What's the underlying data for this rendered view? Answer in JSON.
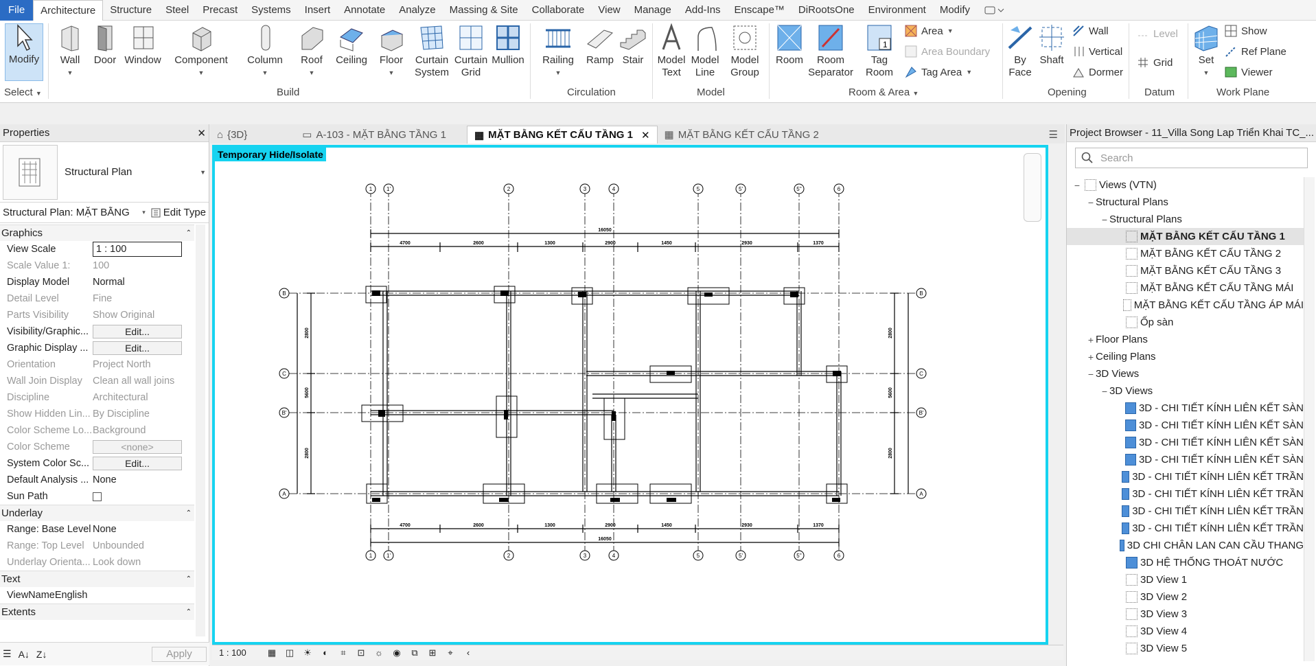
{
  "menu": [
    "File",
    "Architecture",
    "Structure",
    "Steel",
    "Precast",
    "Systems",
    "Insert",
    "Annotate",
    "Analyze",
    "Massing & Site",
    "Collaborate",
    "View",
    "Manage",
    "Add-Ins",
    "Enscape™",
    "DiRootsOne",
    "Environment",
    "Modify"
  ],
  "ribbon": {
    "modify": "Modify",
    "wall": "Wall",
    "door": "Door",
    "window": "Window",
    "component": "Component",
    "column": "Column",
    "roof": "Roof",
    "ceiling": "Ceiling",
    "floor": "Floor",
    "curtain_system": [
      "Curtain",
      "System"
    ],
    "curtain_grid": [
      "Curtain",
      "Grid"
    ],
    "mullion": "Mullion",
    "railing": "Railing",
    "ramp": "Ramp",
    "stair": "Stair",
    "model_text": [
      "Model",
      "Text"
    ],
    "model_line": [
      "Model",
      "Line"
    ],
    "model_group": [
      "Model",
      "Group"
    ],
    "room": "Room",
    "room_separator": [
      "Room",
      "Separator"
    ],
    "tag_room": [
      "Tag",
      "Room"
    ],
    "area": "Area",
    "area_boundary": "Area  Boundary",
    "tag_area": "Tag  Area",
    "by_face": [
      "By",
      "Face"
    ],
    "shaft": "Shaft",
    "wall_o": "Wall",
    "vertical": "Vertical",
    "dormer": "Dormer",
    "level": "Level",
    "grid": "Grid",
    "set": "Set",
    "show": "Show",
    "ref_plane": "Ref  Plane",
    "viewer": "Viewer",
    "panels": {
      "select": "Select",
      "build": "Build",
      "circulation": "Circulation",
      "model": "Model",
      "room_area": "Room & Area",
      "opening": "Opening",
      "datum": "Datum",
      "work_plane": "Work Plane"
    }
  },
  "properties": {
    "title": "Properties",
    "type_name": "Structural Plan",
    "selector": "Structural Plan: MẶT BẰNG",
    "edit_type": "Edit Type",
    "sections": {
      "graphics": "Graphics",
      "underlay": "Underlay",
      "text": "Text",
      "extents": "Extents"
    },
    "rows": [
      {
        "k": "View Scale",
        "v": "1 : 100",
        "kind": "input"
      },
      {
        "k": "Scale Value    1:",
        "v": "100",
        "dis": true
      },
      {
        "k": "Display Model",
        "v": "Normal"
      },
      {
        "k": "Detail Level",
        "v": "Fine",
        "dis": true
      },
      {
        "k": "Parts Visibility",
        "v": "Show Original",
        "dis": true
      },
      {
        "k": "Visibility/Graphic...",
        "v": "Edit...",
        "kind": "button"
      },
      {
        "k": "Graphic Display ...",
        "v": "Edit...",
        "kind": "button"
      },
      {
        "k": "Orientation",
        "v": "Project North",
        "dis": true
      },
      {
        "k": "Wall Join Display",
        "v": "Clean all wall joins",
        "dis": true
      },
      {
        "k": "Discipline",
        "v": "Architectural",
        "dis": true
      },
      {
        "k": "Show Hidden Lin...",
        "v": "By Discipline",
        "dis": true
      },
      {
        "k": "Color Scheme Lo...",
        "v": "Background",
        "dis": true
      },
      {
        "k": "Color Scheme",
        "v": "<none>",
        "kind": "button",
        "dis": true
      },
      {
        "k": "System Color Sc...",
        "v": "Edit...",
        "kind": "button"
      },
      {
        "k": "Default Analysis ...",
        "v": "None"
      },
      {
        "k": "Sun Path",
        "v": "",
        "kind": "checkbox"
      }
    ],
    "underlay_rows": [
      {
        "k": "Range: Base Level",
        "v": "None"
      },
      {
        "k": "Range: Top Level",
        "v": "Unbounded",
        "dis": true
      },
      {
        "k": "Underlay Orienta...",
        "v": "Look down",
        "dis": true
      }
    ],
    "text_rows": [
      {
        "k": "ViewNameEnglish",
        "v": ""
      }
    ],
    "apply": "Apply"
  },
  "tabs": [
    "{3D}",
    "A-103 - MẶT BẰNG TẦNG 1",
    "MẶT BẰNG KẾT CẤU TẦNG 1",
    "MẶT BẰNG KẾT CẤU TẦNG 2"
  ],
  "canvas": {
    "badge": "Temporary Hide/Isolate",
    "scale": "1 : 100",
    "grids_top": [
      "1",
      "1'",
      "2",
      "3",
      "4",
      "5",
      "5'",
      "5''",
      "6"
    ],
    "grids_side": [
      "B",
      "C",
      "B'",
      "A"
    ],
    "dims": [
      "4700",
      "2600",
      "1300",
      "2900",
      "1450",
      "2930",
      "1370"
    ],
    "total": "16050",
    "side_dims": [
      "2800",
      "5600",
      "2800"
    ]
  },
  "browser": {
    "title": "Project Browser - 11_Villa Song Lap Triển Khai TC_...",
    "search": "Search",
    "nodes": [
      {
        "t": "Views (VTN)",
        "lvl": 0,
        "tg": "−",
        "ic": "root"
      },
      {
        "t": "Structural Plans",
        "lvl": 1,
        "tg": "−"
      },
      {
        "t": "Structural Plans",
        "lvl": 2,
        "tg": "−"
      },
      {
        "t": "MẶT BẰNG KẾT CẤU TẦNG 1",
        "lvl": 3,
        "ic": "d",
        "cur": true
      },
      {
        "t": "MẶT BẰNG KẾT CẤU TẦNG 2",
        "lvl": 3,
        "ic": "d"
      },
      {
        "t": "MẶT BẰNG KẾT CẤU TẦNG 3",
        "lvl": 3,
        "ic": "d"
      },
      {
        "t": "MẶT BẰNG KẾT CẤU TẦNG MÁI",
        "lvl": 3,
        "ic": "d"
      },
      {
        "t": "MẶT BẰNG KẾT CẤU TẦNG ÁP MÁI",
        "lvl": 3,
        "ic": "d"
      },
      {
        "t": "Ốp sàn",
        "lvl": 3,
        "ic": "d"
      },
      {
        "t": "Floor Plans",
        "lvl": 1,
        "tg": "+"
      },
      {
        "t": "Ceiling Plans",
        "lvl": 1,
        "tg": "+"
      },
      {
        "t": "3D Views",
        "lvl": 1,
        "tg": "−"
      },
      {
        "t": "3D Views",
        "lvl": 2,
        "tg": "−"
      },
      {
        "t": "3D - CHI TIẾT KÍNH LIÊN KẾT SÀN",
        "lvl": 3,
        "ic": "b"
      },
      {
        "t": "3D - CHI TIẾT KÍNH LIÊN KẾT SÀN",
        "lvl": 3,
        "ic": "b"
      },
      {
        "t": "3D - CHI TIẾT KÍNH LIÊN KẾT SÀN",
        "lvl": 3,
        "ic": "b"
      },
      {
        "t": "3D - CHI TIẾT KÍNH LIÊN KẾT SÀN",
        "lvl": 3,
        "ic": "b"
      },
      {
        "t": "3D - CHI TIẾT KÍNH LIÊN KẾT TRẦN",
        "lvl": 3,
        "ic": "b"
      },
      {
        "t": "3D - CHI TIẾT KÍNH LIÊN KẾT TRẦN",
        "lvl": 3,
        "ic": "b"
      },
      {
        "t": "3D - CHI TIẾT KÍNH LIÊN KẾT TRẦN",
        "lvl": 3,
        "ic": "b"
      },
      {
        "t": "3D - CHI TIẾT KÍNH LIÊN KẾT TRẦN",
        "lvl": 3,
        "ic": "b"
      },
      {
        "t": "3D CHI CHÂN LAN CAN CẦU THANG",
        "lvl": 3,
        "ic": "b"
      },
      {
        "t": "3D HỆ THỐNG THOÁT NƯỚC",
        "lvl": 3,
        "ic": "b"
      },
      {
        "t": "3D View 1",
        "lvl": 3,
        "ic": "d"
      },
      {
        "t": "3D View 2",
        "lvl": 3,
        "ic": "d"
      },
      {
        "t": "3D View 3",
        "lvl": 3,
        "ic": "d"
      },
      {
        "t": "3D View 4",
        "lvl": 3,
        "ic": "d"
      },
      {
        "t": "3D View 5",
        "lvl": 3,
        "ic": "d"
      }
    ]
  }
}
